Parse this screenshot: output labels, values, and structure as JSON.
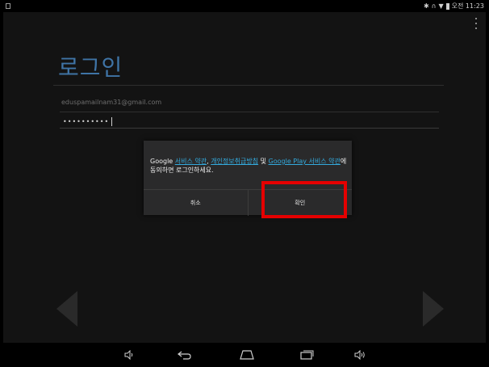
{
  "status_bar": {
    "clock": "오전 11:23",
    "icons": [
      "notification-icon",
      "bluetooth-icon",
      "headset-icon",
      "wifi-icon",
      "battery-icon"
    ]
  },
  "login": {
    "title": "로그인",
    "email": "eduspamailnam31@gmail.com",
    "password_mask": "••••••••••"
  },
  "dialog": {
    "msg_google": "Google ",
    "link_terms": "서비스 약관",
    "sep_comma": ", ",
    "link_privacy": "개인정보취급방침",
    "sep_and": " 및 ",
    "link_play_terms": "Google Play 서비스 약관",
    "msg_tail": "에 동의하면 로그인하세요.",
    "cancel_label": "취소",
    "confirm_label": "확인"
  },
  "colors": {
    "title": "#3f74a6",
    "link": "#33aadd",
    "highlight": "#e50000"
  },
  "nav_bar": {
    "icons": [
      "volume-down-icon",
      "back-icon",
      "home-icon",
      "recent-apps-icon",
      "volume-up-icon"
    ]
  }
}
